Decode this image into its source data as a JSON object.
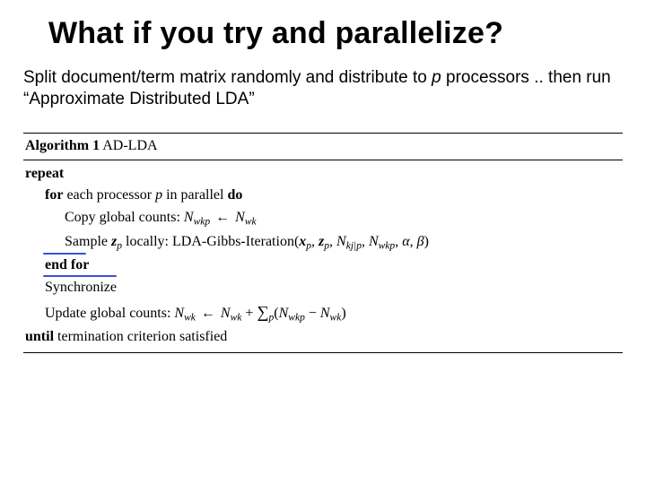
{
  "title": "What if you try and parallelize?",
  "intro": {
    "part1": "Split document/term matrix randomly and distribute to ",
    "p": "p",
    "part2": " processors .. then run “Approximate Distributed LDA”"
  },
  "algorithm": {
    "label": "Algorithm 1",
    "name": "AD-LDA",
    "repeat": "repeat",
    "for_prefix": "for",
    "for_text": " each processor ",
    "for_var": "p",
    "for_text2": " in parallel ",
    "do": "do",
    "copy_line": {
      "text": "Copy global counts: ",
      "lhs": "N",
      "lhs_sub": "wkp",
      "arrow": "←",
      "rhs": "N",
      "rhs_sub": "wk"
    },
    "sample_line": {
      "prefix": "Sample ",
      "z": "z",
      "z_sub": "p",
      "mid": " locally: LDA-Gibbs-Iteration(",
      "args": {
        "x": "x",
        "x_sub": "p",
        "z2": "z",
        "z2_sub": "p",
        "Nkj": "N",
        "Nkj_sub": "kj|p",
        "Nwkp": "N",
        "Nwkp_sub": "wkp",
        "alpha": "α",
        "beta": "β"
      },
      "close": ")"
    },
    "end_for": "end for",
    "synchronize": "Synchronize",
    "update_line": {
      "text": "Update global counts: ",
      "lhs": "N",
      "lhs_sub": "wk",
      "arrow": "←",
      "rhs1": "N",
      "rhs1_sub": "wk",
      "plus": " + ",
      "sum": "∑",
      "sum_sub": "p",
      "open": "(",
      "t1": "N",
      "t1_sub": "wkp",
      "minus": " − ",
      "t2": "N",
      "t2_sub": "wk",
      "close": ")"
    },
    "until": "until",
    "until_text": " termination criterion satisfied"
  }
}
